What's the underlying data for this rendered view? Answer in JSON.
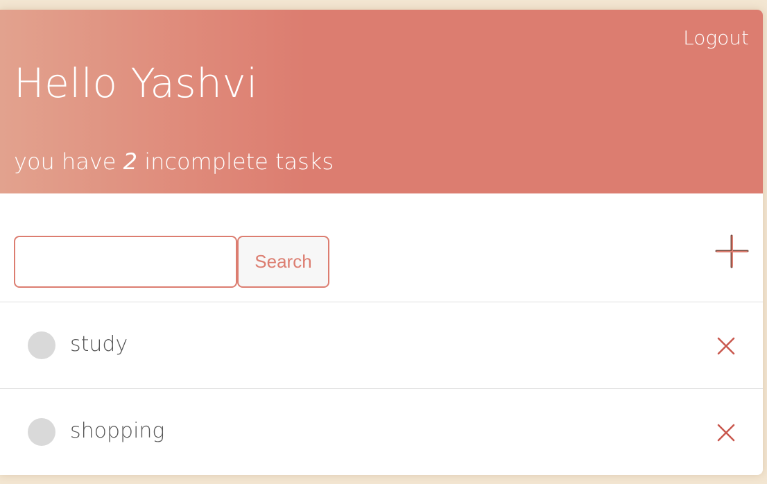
{
  "header": {
    "logout_label": "Logout",
    "greeting": "Hello Yashvi",
    "subtitle_prefix": "you have ",
    "incomplete_count": "2",
    "subtitle_suffix": " incomplete tasks"
  },
  "search": {
    "value": "",
    "placeholder": "",
    "button_label": "Search"
  },
  "toolbar": {
    "add_icon": "plus-icon"
  },
  "tasks": [
    {
      "label": "study",
      "completed": false
    },
    {
      "label": "shopping",
      "completed": false
    }
  ],
  "colors": {
    "accent": "#dc7d70",
    "header_gradient_start": "#e2a28e",
    "background": "#f3e6d2",
    "check_circle": "#d9d9d9",
    "delete_x": "#c9574d"
  }
}
